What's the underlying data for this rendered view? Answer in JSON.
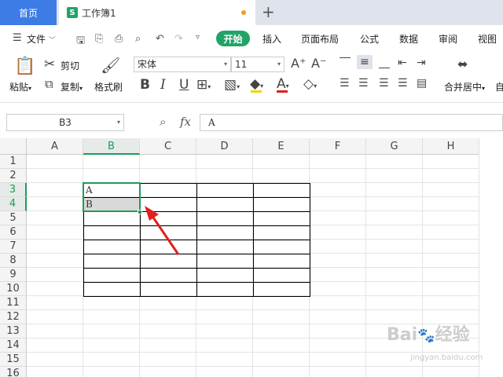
{
  "tabs": {
    "home": "首页",
    "doc_title": "工作簿1",
    "doc_icon_letter": "S"
  },
  "menu": {
    "file": "文件",
    "start": "开始",
    "items": [
      "插入",
      "页面布局",
      "公式",
      "数据",
      "审阅",
      "视图"
    ]
  },
  "ribbon": {
    "paste": "粘贴",
    "cut": "剪切",
    "copy": "复制",
    "format_painter": "格式刷",
    "font_name": "宋体",
    "font_size": "11",
    "merge_center": "合并居中",
    "auto_wrap": "自"
  },
  "formula": {
    "cell_ref": "B3",
    "fx": "fx",
    "value": "A"
  },
  "grid": {
    "columns": [
      "A",
      "B",
      "C",
      "D",
      "E",
      "F",
      "G",
      "H"
    ],
    "rows": [
      "1",
      "2",
      "3",
      "4",
      "5",
      "6",
      "7",
      "8",
      "9",
      "10",
      "11",
      "12",
      "13",
      "14",
      "15",
      "16"
    ],
    "cells": {
      "B3": "A",
      "B4": "B"
    }
  },
  "colors": {
    "accent": "#21a366",
    "home_tab": "#3d7be5",
    "arrow": "#e02020",
    "selection": "#1e9c57"
  }
}
